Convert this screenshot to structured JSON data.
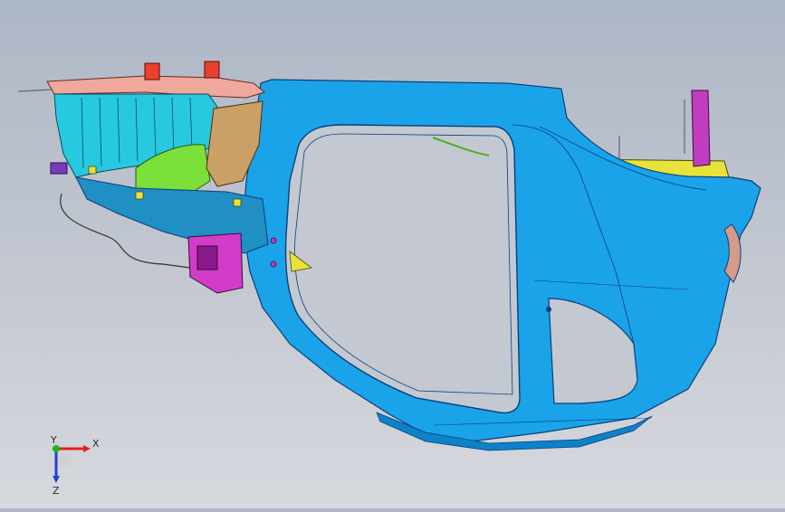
{
  "viewport": {
    "background_top": "#aeb7c6",
    "background_bottom": "#d6d9de"
  },
  "model": {
    "body_color": "#1aa3e8",
    "body_edge": "#0a3f7a",
    "inner_panel_color": "#27c9e0",
    "roof_rail_color": "#f0a89c",
    "pad_color": "#e8412d",
    "bracket_color": "#d23cc9",
    "green_part_color": "#7be03a",
    "tan_part_color": "#caa066",
    "yellow_part_color": "#e8e23a"
  },
  "triad": {
    "x_label": "X",
    "y_label": "Y",
    "z_label": "Z",
    "x_color": "#e02020",
    "y_color": "#20b020",
    "z_color": "#2040d0"
  }
}
